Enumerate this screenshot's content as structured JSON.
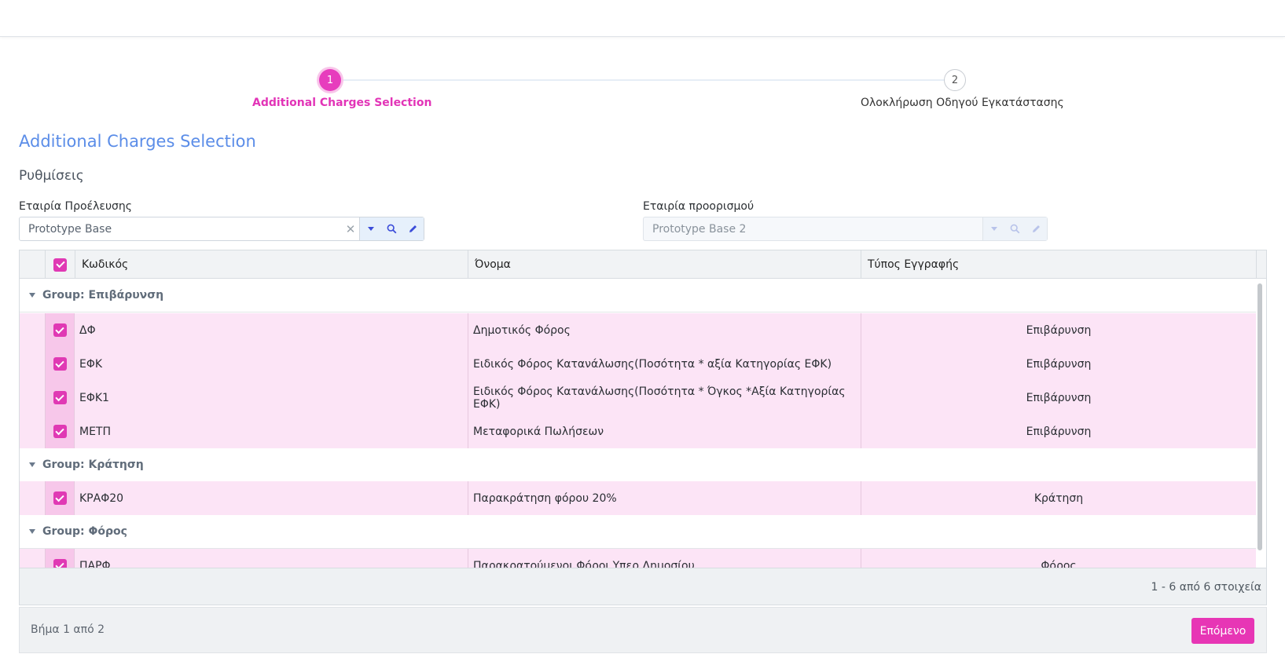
{
  "stepper": {
    "steps": [
      {
        "number": "1",
        "label": "Additional Charges Selection",
        "active": true
      },
      {
        "number": "2",
        "label": "Ολοκλήρωση Οδηγού Εγκατάστασης",
        "active": false
      }
    ]
  },
  "page": {
    "title": "Additional Charges Selection",
    "section": "Ρυθμίσεις"
  },
  "fields": {
    "source_company": {
      "label": "Εταιρία Προέλευσης",
      "value": "Prototype Base"
    },
    "target_company": {
      "label": "Εταιρία προορισμού",
      "value": "Prototype Base 2"
    }
  },
  "grid": {
    "columns": [
      "Κωδικός",
      "Όνομα",
      "Τύπος Εγγραφής"
    ],
    "groups": [
      {
        "label": "Group: Επιβάρυνση",
        "rows": [
          {
            "code": "ΔΦ",
            "name": "Δημοτικός Φόρος",
            "type": "Επιβάρυνση",
            "checked": true
          },
          {
            "code": "ΕΦΚ",
            "name": "Ειδικός Φόρος Κατανάλωσης(Ποσότητα * αξία Κατηγορίας ΕΦΚ)",
            "type": "Επιβάρυνση",
            "checked": true
          },
          {
            "code": "ΕΦΚ1",
            "name": "Ειδικός Φόρος Κατανάλωσης(Ποσότητα * Όγκος *Αξία Κατηγορίας ΕΦΚ)",
            "type": "Επιβάρυνση",
            "checked": true
          },
          {
            "code": "ΜΕΤΠ",
            "name": "Μεταφορικά Πωλήσεων",
            "type": "Επιβάρυνση",
            "checked": true
          }
        ]
      },
      {
        "label": "Group: Κράτηση",
        "rows": [
          {
            "code": "ΚΡΑΦ20",
            "name": "Παρακράτηση φόρου 20%",
            "type": "Κράτηση",
            "checked": true
          }
        ]
      },
      {
        "label": "Group: Φόρος",
        "rows": [
          {
            "code": "ΠΑΡΦ",
            "name": "Παρακρατούμενοι Φόροι Υπερ Δημοσίου",
            "type": "Φόρος",
            "checked": true
          }
        ]
      }
    ],
    "pager_info": "1 - 6 από 6 στοιχεία"
  },
  "footer": {
    "step_text": "Βήμα 1 από 2",
    "next_label": "Επόμενο"
  },
  "colors": {
    "accent": "#e736b5",
    "title_blue": "#5b8de8",
    "row_selected": "#fce4f6"
  }
}
